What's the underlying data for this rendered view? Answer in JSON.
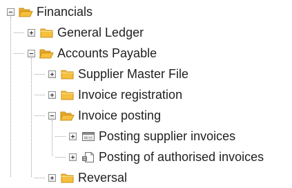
{
  "tree": {
    "financials": {
      "label": "Financials",
      "icon": "folder-open-icon",
      "state": "expanded"
    },
    "general_ledger": {
      "label": "General Ledger",
      "icon": "folder-closed-icon",
      "state": "collapsed"
    },
    "accounts_payable": {
      "label": "Accounts Payable",
      "icon": "folder-open-icon",
      "state": "expanded"
    },
    "supplier_master_file": {
      "label": "Supplier Master File",
      "icon": "folder-closed-icon",
      "state": "collapsed"
    },
    "invoice_registration": {
      "label": "Invoice registration",
      "icon": "folder-closed-icon",
      "state": "collapsed"
    },
    "invoice_posting": {
      "label": "Invoice posting",
      "icon": "folder-open-icon",
      "state": "expanded"
    },
    "posting_supplier_invoices": {
      "label": "Posting supplier invoices",
      "icon": "form-window-icon",
      "state": "collapsed"
    },
    "posting_authorised_invoices": {
      "label": "Posting of authorised invoices",
      "icon": "authorised-document-icon",
      "state": "collapsed"
    },
    "reversal": {
      "label": "Reversal",
      "icon": "folder-closed-icon",
      "state": "collapsed"
    }
  },
  "colors": {
    "folder_fill": "#f6bf3c",
    "folder_edge": "#c98d16",
    "connector_line": "#9c9c9c",
    "text": "#1f1f1f"
  }
}
